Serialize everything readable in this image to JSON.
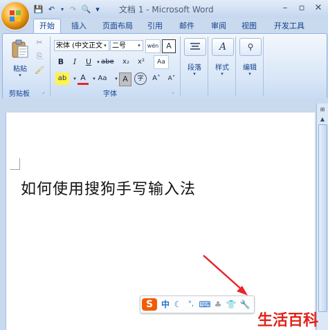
{
  "window": {
    "title": "文档 1 - Microsoft Word",
    "minimize": "–",
    "maximize": "▫",
    "close": "✕"
  },
  "quick_access": {
    "save": "💾",
    "undo": "↶",
    "redo": "↷",
    "print_preview": "🔍",
    "customize": "▾"
  },
  "tabs": [
    "开始",
    "插入",
    "页面布局",
    "引用",
    "邮件",
    "审阅",
    "视图",
    "开发工具"
  ],
  "ribbon": {
    "clipboard": {
      "label": "剪贴板",
      "paste_label": "粘贴",
      "cut": "✂",
      "copy": "⎘",
      "format_painter": "🖌"
    },
    "font": {
      "label": "字体",
      "font_name": "宋体 (中文正文",
      "font_size": "二号",
      "bold": "B",
      "italic": "I",
      "underline": "U",
      "strike": "abe",
      "subscript": "x₂",
      "superscript": "x²",
      "clear": "Aa",
      "phonetic": "wén",
      "border": "A",
      "highlight": "ab",
      "color": "A",
      "case": "Aa",
      "shade": "A",
      "enclose": "字",
      "grow": "A˄",
      "shrink": "A˅"
    },
    "paragraph": {
      "label": "段落"
    },
    "styles": {
      "label": "样式"
    },
    "editing": {
      "label": "编辑"
    }
  },
  "document": {
    "text": "如何使用搜狗手写输入法"
  },
  "ime_toolbar": {
    "logo": "S",
    "mode": "中",
    "moon": "☾",
    "punct": "°,",
    "keyboard": "⌨",
    "voice": "♣",
    "skin": "👕",
    "tools": "🔧"
  },
  "watermark": "生活百科",
  "colors": {
    "accent": "#15428b",
    "arrow": "#e8242c",
    "watermark": "#e2231a"
  }
}
